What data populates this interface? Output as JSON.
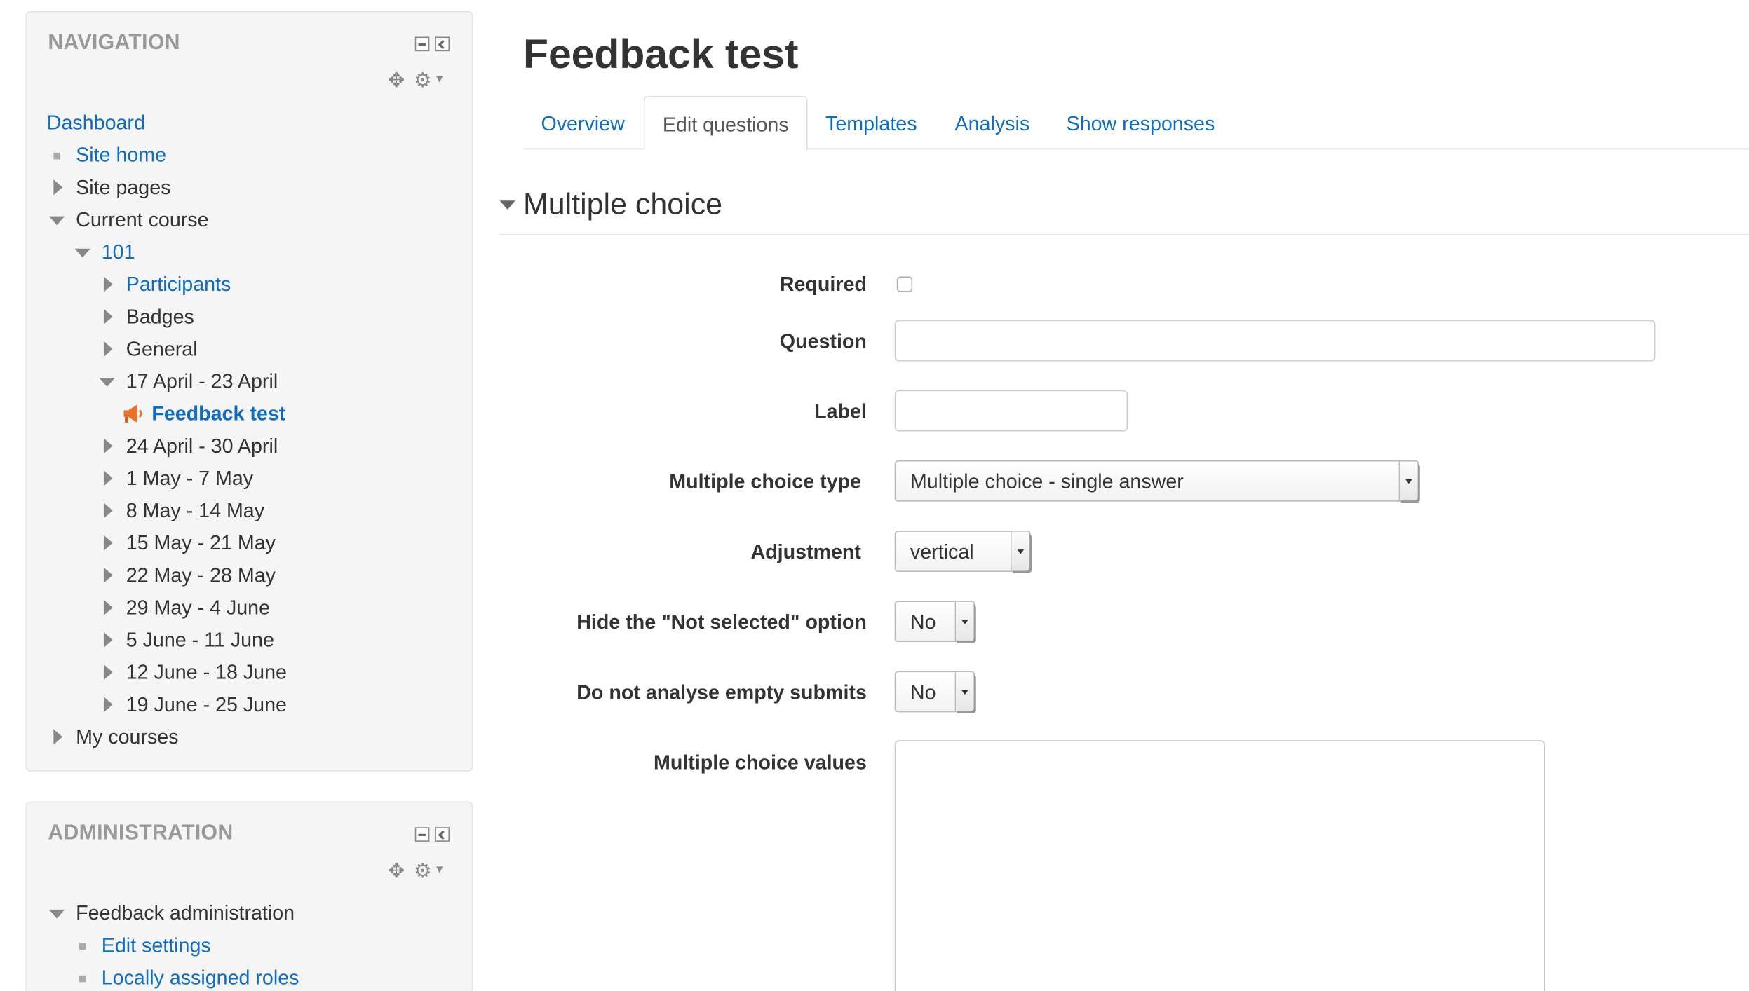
{
  "navigation": {
    "title": "NAVIGATION",
    "dashboard": "Dashboard",
    "site_home": "Site home",
    "site_pages": "Site pages",
    "current_course": "Current course",
    "course": "101",
    "participants": "Participants",
    "badges": "Badges",
    "general": "General",
    "week_current": "17 April - 23 April",
    "feedback_test": "Feedback test",
    "weeks": [
      "24 April - 30 April",
      "1 May - 7 May",
      "8 May - 14 May",
      "15 May - 21 May",
      "22 May - 28 May",
      "29 May - 4 June",
      "5 June - 11 June",
      "12 June - 18 June",
      "19 June - 25 June"
    ],
    "my_courses": "My courses"
  },
  "administration": {
    "title": "ADMINISTRATION",
    "feedback_admin": "Feedback administration",
    "edit_settings": "Edit settings",
    "locally_assigned_roles": "Locally assigned roles"
  },
  "main": {
    "title": "Feedback test",
    "tabs": [
      {
        "label": "Overview"
      },
      {
        "label": "Edit questions"
      },
      {
        "label": "Templates"
      },
      {
        "label": "Analysis"
      },
      {
        "label": "Show responses"
      }
    ],
    "active_tab": "Edit questions",
    "section_title": "Multiple choice",
    "form": {
      "required_label": "Required",
      "required_checked": false,
      "question_label": "Question",
      "question_value": "",
      "label_label": "Label",
      "label_value": "",
      "mc_type_label": "Multiple choice type",
      "mc_type_value": "Multiple choice - single answer",
      "adjustment_label": "Adjustment",
      "adjustment_value": "vertical",
      "hide_not_selected_label": "Hide the \"Not selected\" option",
      "hide_not_selected_value": "No",
      "no_analyse_empty_label": "Do not analyse empty submits",
      "no_analyse_empty_value": "No",
      "mc_values_label": "Multiple choice values",
      "mc_values_value": ""
    }
  },
  "colors": {
    "link": "#0f6cbf",
    "text": "#333333",
    "block_bg": "#f5f5f5",
    "block_title": "#999999"
  },
  "icons": {
    "feedback": "feedback-megaphone-icon",
    "move": "move-icon",
    "gear": "gear-icon",
    "minimize": "minimize-icon",
    "dock": "dock-icon"
  }
}
